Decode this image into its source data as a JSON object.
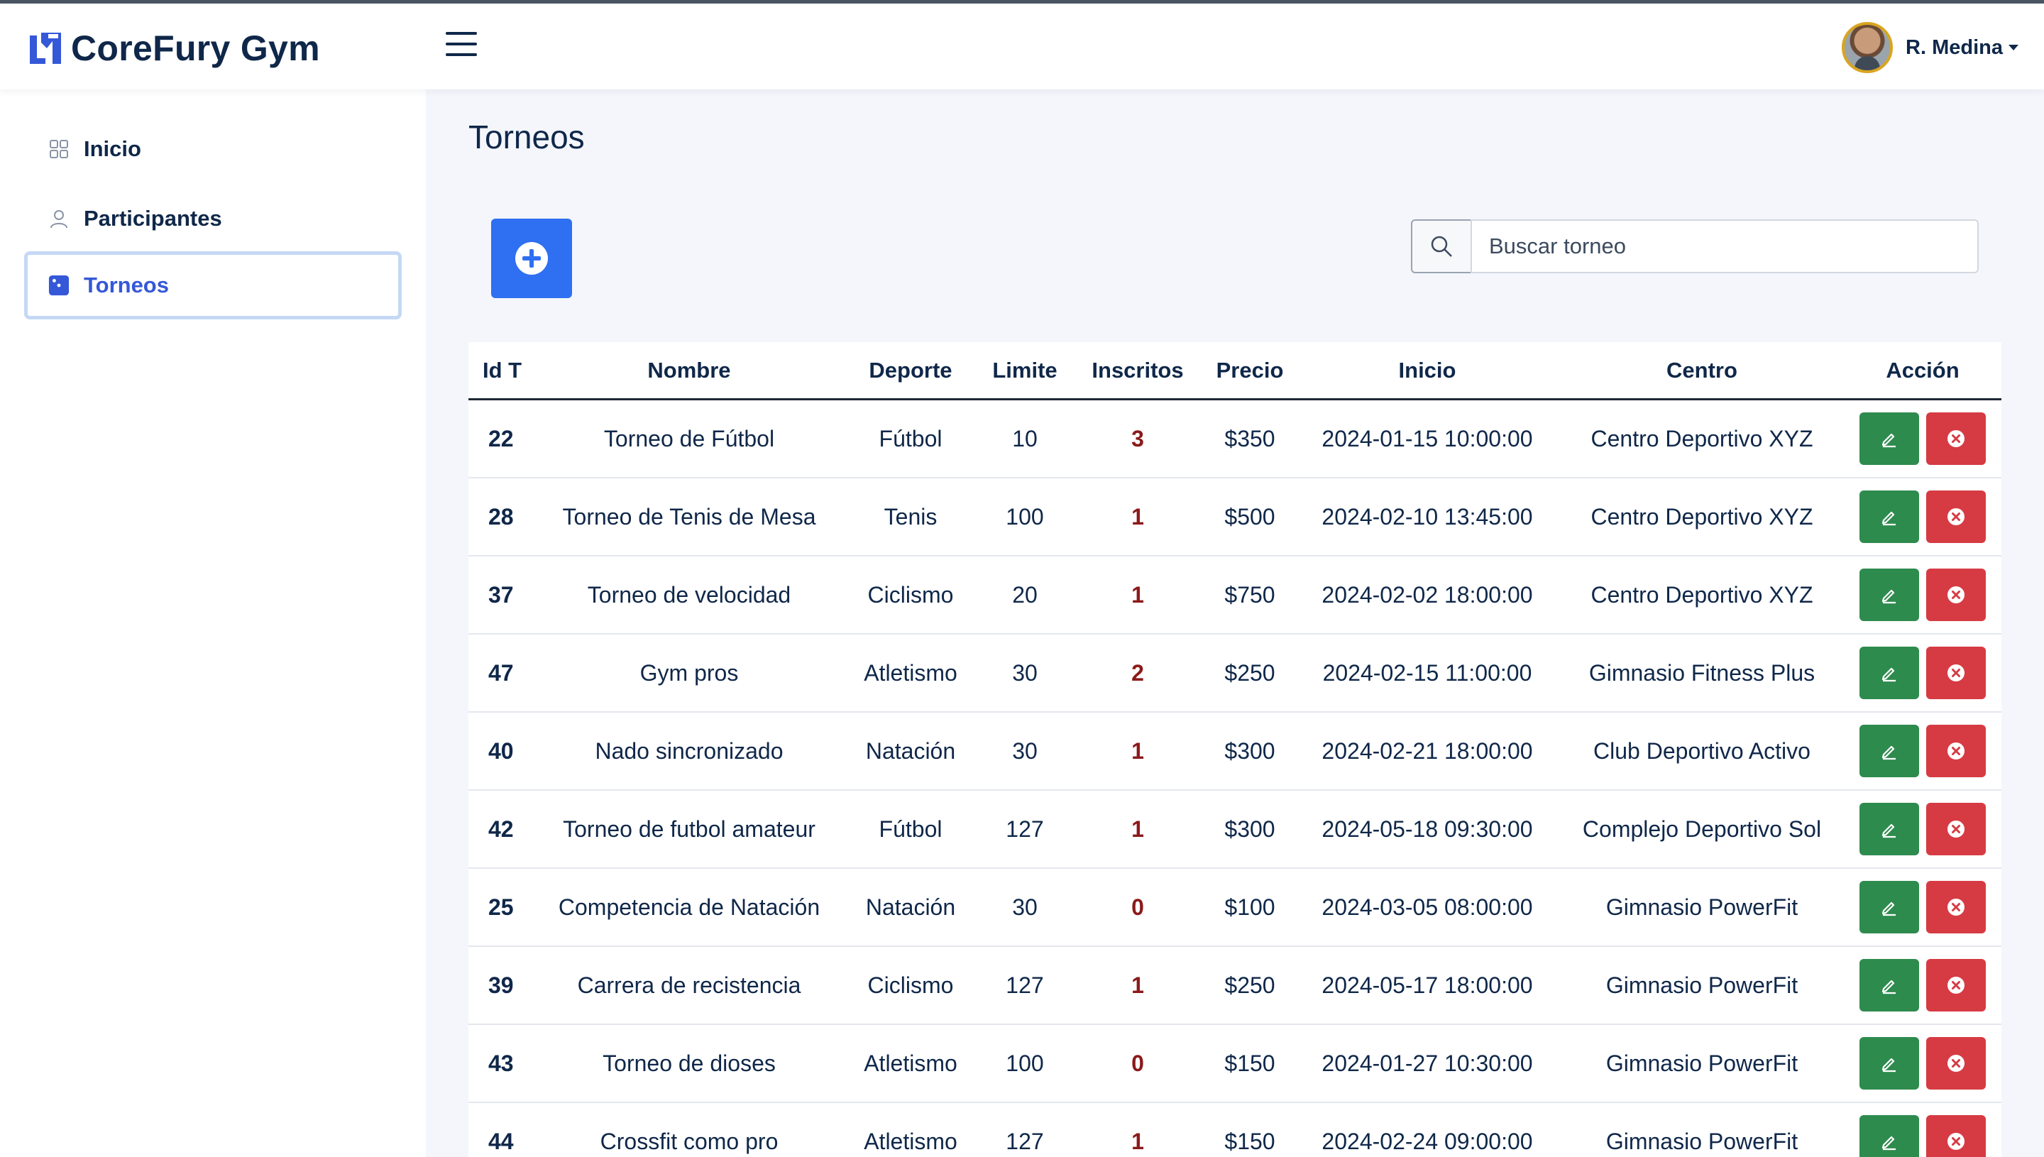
{
  "app": {
    "name": "CoreFury Gym"
  },
  "user": {
    "name": "R. Medina"
  },
  "sidebar": {
    "items": [
      {
        "label": "Inicio",
        "icon": "grid-icon"
      },
      {
        "label": "Participantes",
        "icon": "user-icon"
      },
      {
        "label": "Torneos",
        "icon": "dice-icon",
        "active": true
      }
    ]
  },
  "page": {
    "title": "Torneos"
  },
  "search": {
    "placeholder": "Buscar torneo"
  },
  "table": {
    "headers": [
      "Id T",
      "Nombre",
      "Deporte",
      "Limite",
      "Inscritos",
      "Precio",
      "Inicio",
      "Centro",
      "Acción"
    ],
    "rows": [
      {
        "id": "22",
        "name": "Torneo de Fútbol",
        "sport": "Fútbol",
        "limit": "10",
        "enrolled": "3",
        "price": "$350",
        "start": "2024-01-15 10:00:00",
        "center": "Centro Deportivo XYZ"
      },
      {
        "id": "28",
        "name": "Torneo de Tenis de Mesa",
        "sport": "Tenis",
        "limit": "100",
        "enrolled": "1",
        "price": "$500",
        "start": "2024-02-10 13:45:00",
        "center": "Centro Deportivo XYZ"
      },
      {
        "id": "37",
        "name": "Torneo de velocidad",
        "sport": "Ciclismo",
        "limit": "20",
        "enrolled": "1",
        "price": "$750",
        "start": "2024-02-02 18:00:00",
        "center": "Centro Deportivo XYZ"
      },
      {
        "id": "47",
        "name": "Gym pros",
        "sport": "Atletismo",
        "limit": "30",
        "enrolled": "2",
        "price": "$250",
        "start": "2024-02-15 11:00:00",
        "center": "Gimnasio Fitness Plus"
      },
      {
        "id": "40",
        "name": "Nado sincronizado",
        "sport": "Natación",
        "limit": "30",
        "enrolled": "1",
        "price": "$300",
        "start": "2024-02-21 18:00:00",
        "center": "Club Deportivo Activo"
      },
      {
        "id": "42",
        "name": "Torneo de futbol amateur",
        "sport": "Fútbol",
        "limit": "127",
        "enrolled": "1",
        "price": "$300",
        "start": "2024-05-18 09:30:00",
        "center": "Complejo Deportivo Sol"
      },
      {
        "id": "25",
        "name": "Competencia de Natación",
        "sport": "Natación",
        "limit": "30",
        "enrolled": "0",
        "price": "$100",
        "start": "2024-03-05 08:00:00",
        "center": "Gimnasio PowerFit"
      },
      {
        "id": "39",
        "name": "Carrera de recistencia",
        "sport": "Ciclismo",
        "limit": "127",
        "enrolled": "1",
        "price": "$250",
        "start": "2024-05-17 18:00:00",
        "center": "Gimnasio PowerFit"
      },
      {
        "id": "43",
        "name": "Torneo de dioses",
        "sport": "Atletismo",
        "limit": "100",
        "enrolled": "0",
        "price": "$150",
        "start": "2024-01-27 10:30:00",
        "center": "Gimnasio PowerFit"
      },
      {
        "id": "44",
        "name": "Crossfit como pro",
        "sport": "Atletismo",
        "limit": "127",
        "enrolled": "1",
        "price": "$150",
        "start": "2024-02-24 09:00:00",
        "center": "Gimnasio PowerFit"
      }
    ]
  },
  "colors": {
    "primary": "#2f6ff2",
    "edit": "#2e8b4e",
    "delete": "#d63b43",
    "enrolled": "#8b1a1a",
    "text": "#0f2749"
  }
}
